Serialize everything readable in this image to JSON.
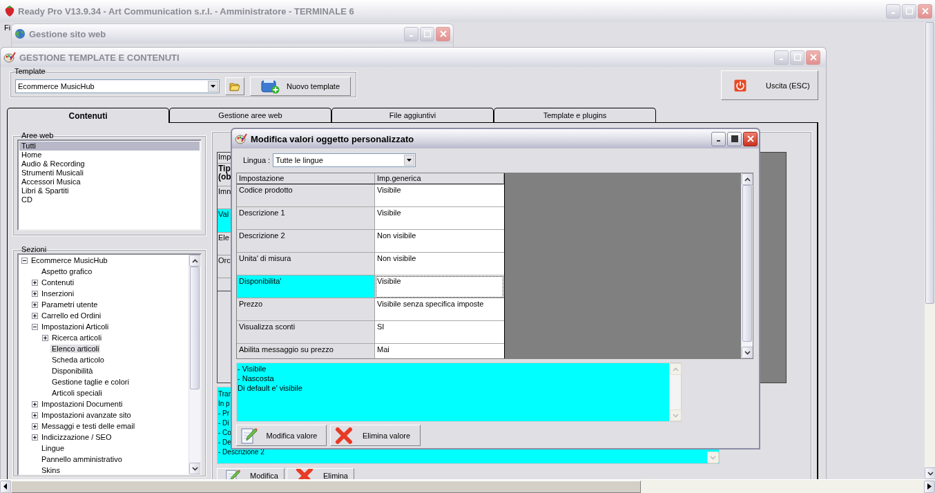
{
  "app_window": {
    "title": "Ready Pro V13.9.34 - Art Communication s.r.l. - Amministratore - TERMINALE 6",
    "menu": [
      "Fi"
    ]
  },
  "site_window": {
    "title": "Gestione sito web"
  },
  "template_window": {
    "title": "GESTIONE TEMPLATE E CONTENUTI",
    "template_label": "Template",
    "template_value": "Ecommerce MusicHub",
    "new_template_button": "Nuovo template",
    "exit_button": "Uscita (ESC)",
    "tabs": [
      {
        "label": "Contenuti",
        "selected": true
      },
      {
        "label": "Gestione aree web",
        "selected": false
      },
      {
        "label": "File aggiuntivi",
        "selected": false
      },
      {
        "label": "Template e plugins",
        "selected": false
      }
    ],
    "aree_web": {
      "label": "Aree web",
      "items": [
        {
          "label": "Tutti",
          "selected": true
        },
        {
          "label": "Home",
          "selected": false
        },
        {
          "label": "Audio & Recording",
          "selected": false
        },
        {
          "label": "Strumenti Musicali",
          "selected": false
        },
        {
          "label": "Accessori Musica",
          "selected": false
        },
        {
          "label": "Libri & Spartiti",
          "selected": false
        },
        {
          "label": "CD",
          "selected": false
        }
      ]
    },
    "sezioni": {
      "label": "Sezioni",
      "tree": [
        {
          "label": "Ecommerce MusicHub",
          "kind": "branch",
          "expanded": true,
          "selected": false,
          "children": [
            {
              "label": "Aspetto grafico",
              "kind": "leaf",
              "selected": false
            },
            {
              "label": "Contenuti",
              "kind": "branch",
              "expanded": false,
              "selected": false
            },
            {
              "label": "Inserzioni",
              "kind": "branch",
              "expanded": false,
              "selected": false
            },
            {
              "label": "Parametri utente",
              "kind": "branch",
              "expanded": false,
              "selected": false
            },
            {
              "label": "Carrello ed Ordini",
              "kind": "branch",
              "expanded": false,
              "selected": false
            },
            {
              "label": "Impostazioni Articoli",
              "kind": "branch",
              "expanded": true,
              "selected": false,
              "children": [
                {
                  "label": "Ricerca articoli",
                  "kind": "branch",
                  "expanded": false,
                  "selected": false
                },
                {
                  "label": "Elenco articoli",
                  "kind": "leaf",
                  "selected": true
                },
                {
                  "label": "Scheda articolo",
                  "kind": "leaf",
                  "selected": false
                },
                {
                  "label": "Disponibilità",
                  "kind": "leaf",
                  "selected": false
                },
                {
                  "label": "Gestione taglie e colori",
                  "kind": "leaf",
                  "selected": false
                },
                {
                  "label": "Articoli speciali",
                  "kind": "leaf",
                  "selected": false
                }
              ]
            },
            {
              "label": "Impostazioni Documenti",
              "kind": "branch",
              "expanded": false,
              "selected": false
            },
            {
              "label": "Impostazioni avanzate sito",
              "kind": "branch",
              "expanded": false,
              "selected": false
            },
            {
              "label": "Messaggi e testi delle email",
              "kind": "branch",
              "expanded": false,
              "selected": false
            },
            {
              "label": "Indicizzazione / SEO",
              "kind": "branch",
              "expanded": false,
              "selected": false
            },
            {
              "label": "Lingue",
              "kind": "leaf",
              "selected": false
            },
            {
              "label": "Pannello amministrativo",
              "kind": "leaf",
              "selected": false
            },
            {
              "label": "Skins",
              "kind": "leaf",
              "selected": false
            }
          ]
        }
      ]
    },
    "grid_rows": [
      {
        "lines": [
          "Imp"
        ],
        "kind": "header",
        "selected": false
      },
      {
        "lines": [
          "Tip",
          "(ob"
        ],
        "kind": "bold",
        "selected": false
      },
      {
        "lines": [
          "Imn"
        ],
        "kind": "plain",
        "selected": false
      },
      {
        "lines": [
          "Val"
        ],
        "kind": "plain",
        "selected": true
      },
      {
        "lines": [
          "Ele"
        ],
        "kind": "plain",
        "selected": false
      },
      {
        "lines": [
          "Orc"
        ],
        "kind": "plain",
        "selected": false
      }
    ],
    "notes_lines": [
      "Tran",
      "In p",
      "- Pr",
      "- Di",
      "- Co",
      "- De",
      "- Descrizione 2"
    ],
    "buttons": [
      {
        "label": "Modifica",
        "kind": "edit"
      },
      {
        "label": "Elimina",
        "kind": "delete"
      }
    ]
  },
  "dialog": {
    "title": "Modifica valori oggetto personalizzato",
    "language_label": "Lingua :",
    "language_value": "Tutte le lingue",
    "columns": [
      "Impostazione",
      "Imp.generica"
    ],
    "rows": [
      {
        "setting": "Codice prodotto",
        "value": "Visibile",
        "selected": false
      },
      {
        "setting": "Descrizione 1",
        "value": "Visibile",
        "selected": false
      },
      {
        "setting": "Descrizione 2",
        "value": "Non visibile",
        "selected": false
      },
      {
        "setting": "Unita' di misura",
        "value": "Non visibile",
        "selected": false
      },
      {
        "setting": "Disponibilita'",
        "value": "Visibile",
        "selected": true
      },
      {
        "setting": "Prezzo",
        "value": "Visibile senza specifica imposte",
        "selected": false
      },
      {
        "setting": "Visualizza sconti",
        "value": "SI",
        "selected": false
      },
      {
        "setting": "Abilita messaggio su prezzo",
        "value": "Mai",
        "selected": false
      }
    ],
    "description_lines": [
      "- Visibile",
      "- Nascosta",
      "Di default e' visibile"
    ],
    "buttons": [
      {
        "label": "Modifica valore",
        "kind": "edit"
      },
      {
        "label": "Elimina valore",
        "kind": "delete"
      }
    ]
  }
}
